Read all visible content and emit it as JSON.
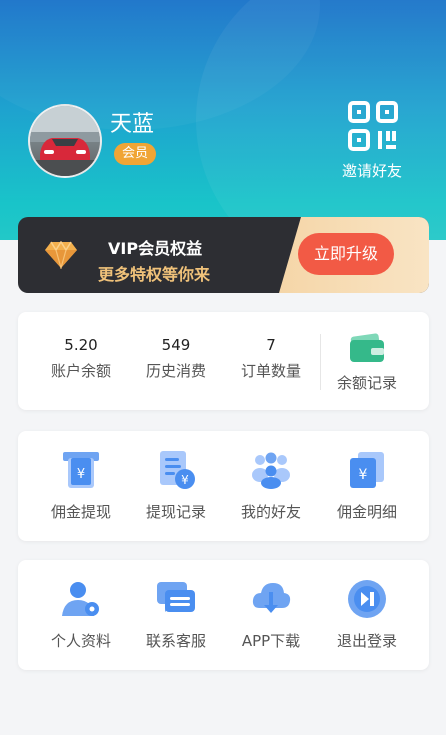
{
  "profile": {
    "username": "天蓝",
    "member_badge": "会员",
    "invite_label": "邀请好友",
    "avatar_icon": "avatar-car-photo",
    "invite_icon": "qr-code-icon"
  },
  "vip": {
    "title": "VIP会员权益",
    "subtitle": "更多特权等你来",
    "upgrade_label": "立即升级",
    "icon": "diamond-icon",
    "colors": {
      "card": "#2d2e33",
      "accent": "#f0c27a",
      "button": "#f25a45"
    }
  },
  "stats": [
    {
      "value": "5.20",
      "label": "账户余额"
    },
    {
      "value": "549",
      "label": "历史消费"
    },
    {
      "value": "7",
      "label": "订单数量"
    }
  ],
  "balance_record": {
    "label": "余额记录",
    "icon": "wallet-icon"
  },
  "menu1": [
    {
      "label": "佣金提现",
      "icon": "withdraw-icon"
    },
    {
      "label": "提现记录",
      "icon": "record-icon"
    },
    {
      "label": "我的好友",
      "icon": "friends-icon"
    },
    {
      "label": "佣金明细",
      "icon": "commission-detail-icon"
    }
  ],
  "menu2": [
    {
      "label": "个人资料",
      "icon": "profile-icon"
    },
    {
      "label": "联系客服",
      "icon": "customer-service-icon"
    },
    {
      "label": "APP下载",
      "icon": "download-icon"
    },
    {
      "label": "退出登录",
      "icon": "logout-icon"
    }
  ]
}
